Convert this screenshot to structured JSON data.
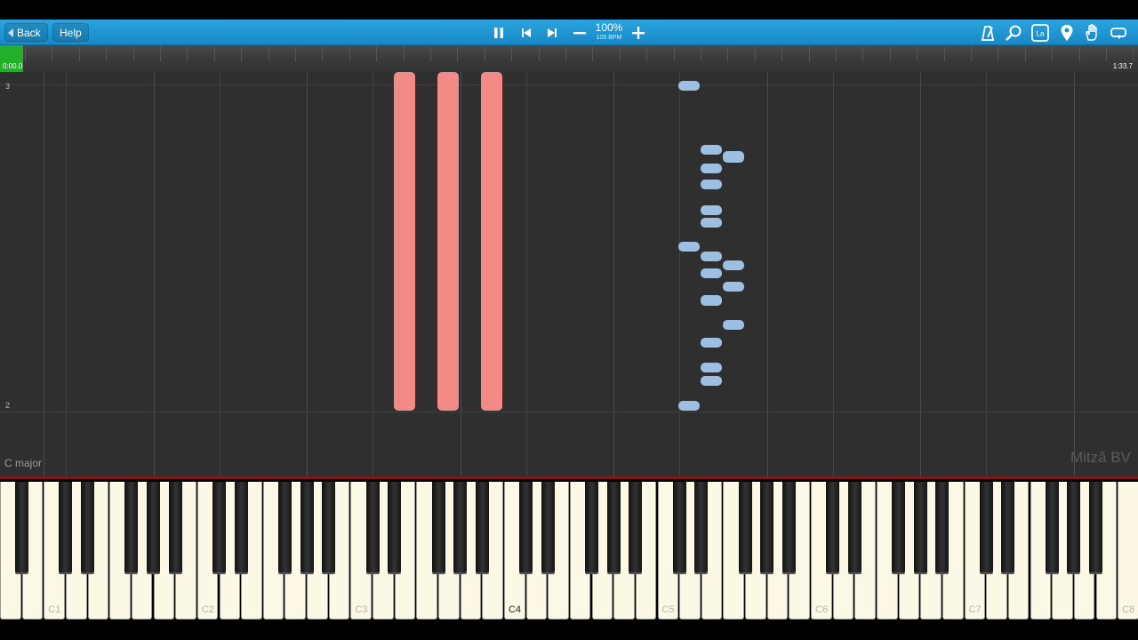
{
  "toolbar": {
    "back_label": "Back",
    "help_label": "Help",
    "speed_percent": "100%",
    "tempo": "105 BPM",
    "icons": [
      "pause-icon",
      "skip-back-icon",
      "skip-forward-icon",
      "minus-icon",
      "plus-icon",
      "metronome-icon",
      "magnifier-icon",
      "label-icon",
      "location-pin-icon",
      "hand-icon",
      "loop-icon"
    ],
    "label_icon_text": "La"
  },
  "timeline": {
    "start_time": "0:00.0",
    "end_time": "1:33.7",
    "progress_fraction": 0.02
  },
  "roll": {
    "measure_top": "3",
    "measure_bottom": "2",
    "key_signature": "C major",
    "watermark": "Mitză BV",
    "colors": {
      "right_hand": "#f28b85",
      "left_hand": "#9dbfe2",
      "background": "#2f2f30"
    }
  },
  "keyboard": {
    "octave_labels": [
      "C1",
      "C2",
      "C3",
      "C4",
      "C5",
      "C6",
      "C7",
      "C8"
    ],
    "highlight_label": "C4"
  }
}
